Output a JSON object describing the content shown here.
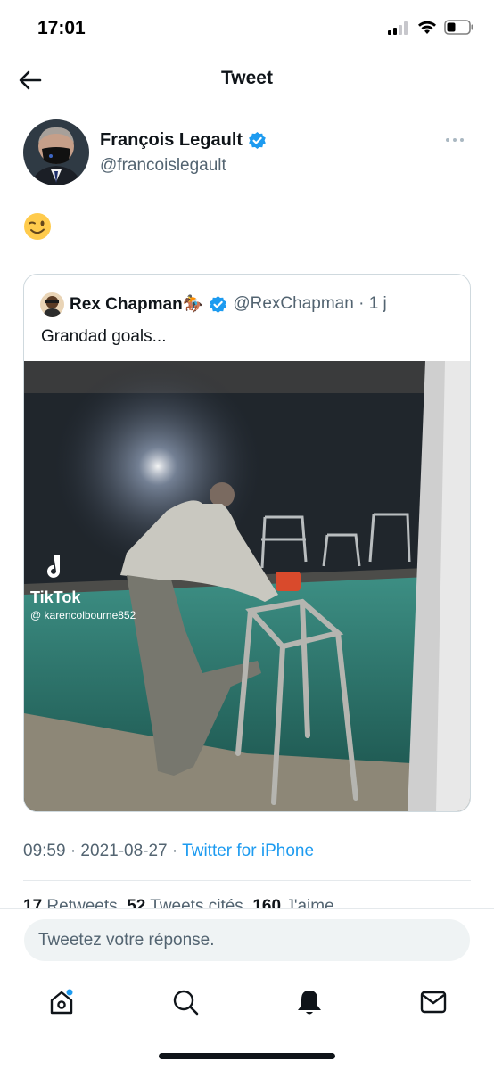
{
  "status": {
    "time": "17:01"
  },
  "nav": {
    "title": "Tweet"
  },
  "tweet": {
    "author_name": "François Legault",
    "author_handle": "@francoislegault",
    "emoji": "😉",
    "timestamp": "09:59 · 2021-08-27 · ",
    "source": "Twitter for iPhone"
  },
  "quoted": {
    "name": "Rex Chapman🏇",
    "handle": "@RexChapman · 1 j",
    "text": "Grandad goals...",
    "tiktok_label": "TikTok",
    "tiktok_user": "@ karencolbourne852"
  },
  "stats": {
    "retweets_count": "17",
    "retweets_label": " Retweets  ",
    "quotes_count": "52",
    "quotes_label": " Tweets cités  ",
    "likes_count": "160",
    "likes_label": " J'aime"
  },
  "reply": {
    "placeholder": "Tweetez votre réponse."
  },
  "colors": {
    "accent": "#1d9bf0",
    "verified": "#1d9bf0",
    "text": "#0f1419",
    "secondary": "#536471"
  },
  "icons": {
    "back": "arrow-left-icon",
    "verified": "verified-badge-icon",
    "more": "more-dots-icon",
    "tabs": [
      "home-icon",
      "search-icon",
      "bell-icon",
      "mail-icon"
    ]
  }
}
